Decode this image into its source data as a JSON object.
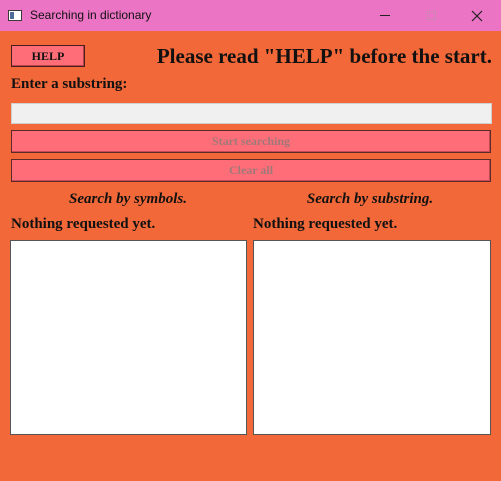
{
  "window": {
    "title": "Searching in dictionary",
    "controls": {
      "minimize": "minimize",
      "maximize": "maximize",
      "close": "✕"
    }
  },
  "header": {
    "help_label": "HELP",
    "help_note": "Please read \"HELP\" before the start."
  },
  "search": {
    "prompt": "Enter a substring:",
    "value": "",
    "placeholder": ""
  },
  "actions": {
    "start_label": "Start searching",
    "clear_label": "Clear all"
  },
  "columns": [
    {
      "heading": "Search by symbols.",
      "status": "Nothing requested yet."
    },
    {
      "heading": "Search by substring.",
      "status": "Nothing requested yet."
    }
  ],
  "colors": {
    "background": "#f26838",
    "titlebar": "#ec74c4",
    "button": "#ff6e78",
    "input": "#f0f0f0"
  }
}
